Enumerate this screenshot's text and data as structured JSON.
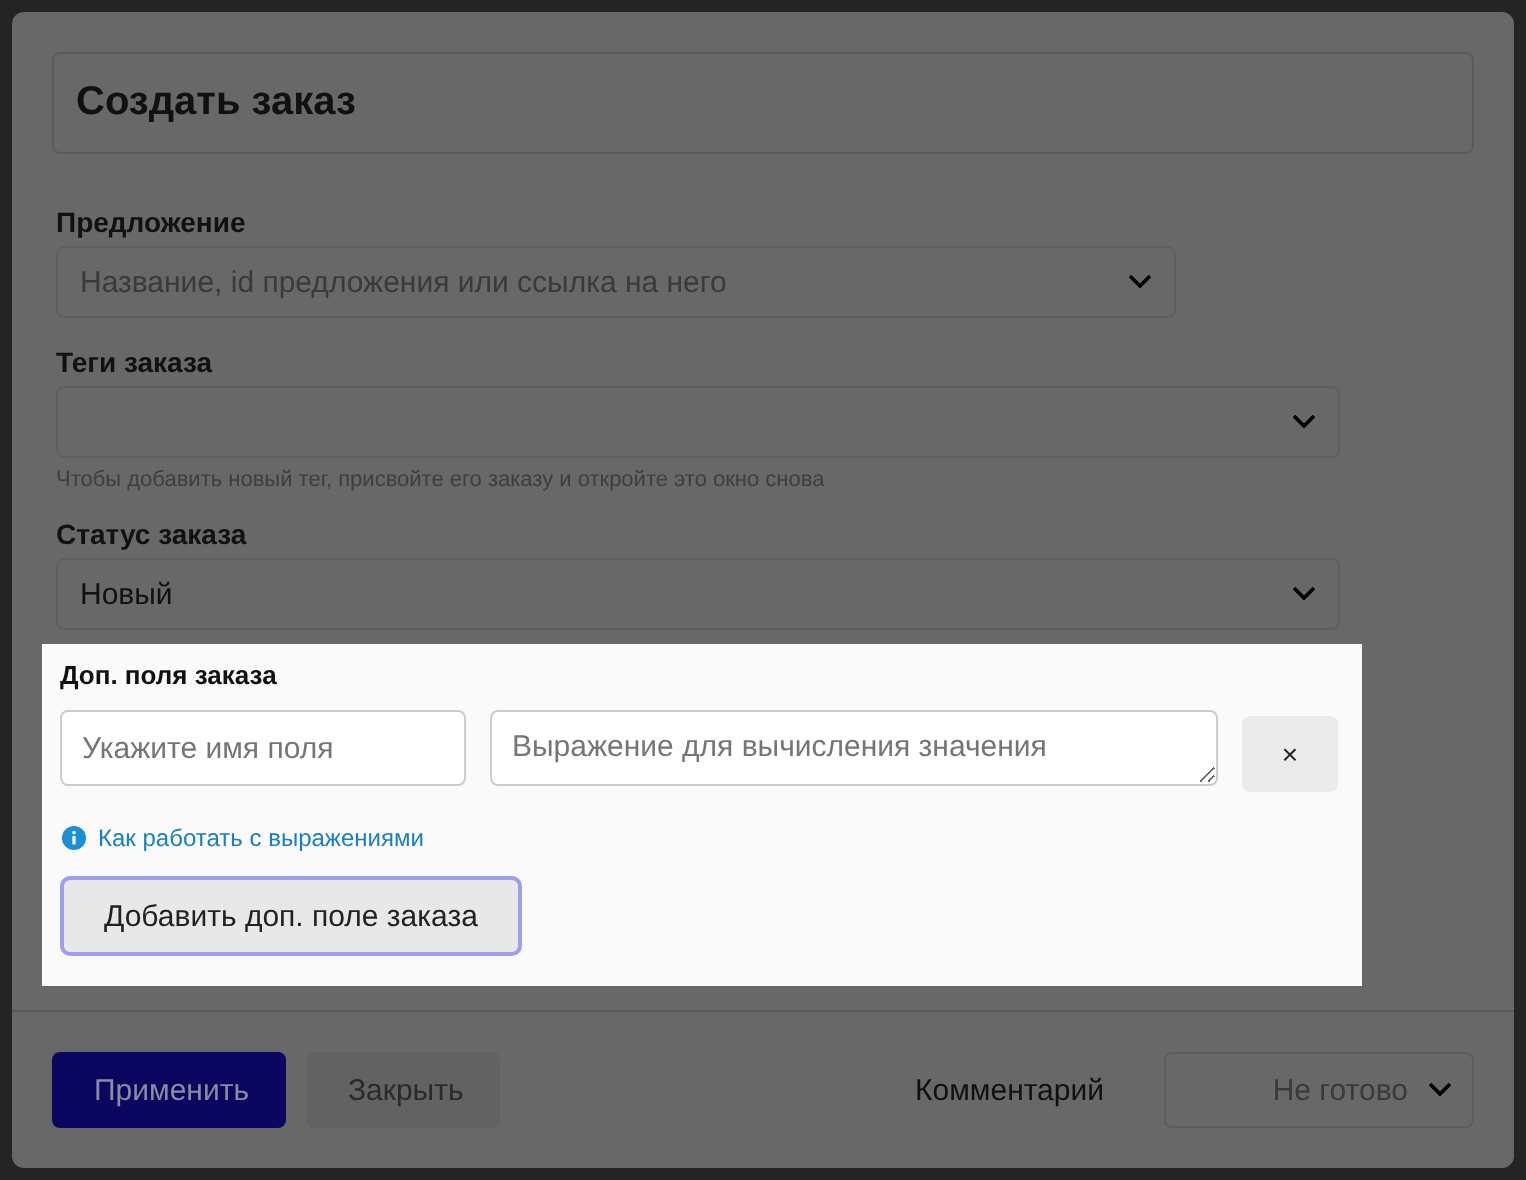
{
  "dialog": {
    "title": "Создать заказ"
  },
  "fields": [
    {
      "label": "Предложение",
      "placeholder": "Название, id предложения или ссылка на него"
    },
    {
      "label": "Теги заказа",
      "hint": "Чтобы добавить новый тег, присвойте его заказу и откройте это окно снова"
    },
    {
      "label": "Статус заказа",
      "value": "Новый"
    }
  ],
  "extra_fields": {
    "label": "Доп. поля заказа",
    "name_placeholder": "Укажите имя поля",
    "expression_placeholder": "Выражение для вычисления значения",
    "remove": "×",
    "help_link": "Как работать с выражениями",
    "add_button": "Добавить доп. поле заказа",
    "add_focused": true
  },
  "footer": {
    "apply": "Применить",
    "close": "Закрыть",
    "comment": "Комментарий",
    "status": "Не готово"
  }
}
